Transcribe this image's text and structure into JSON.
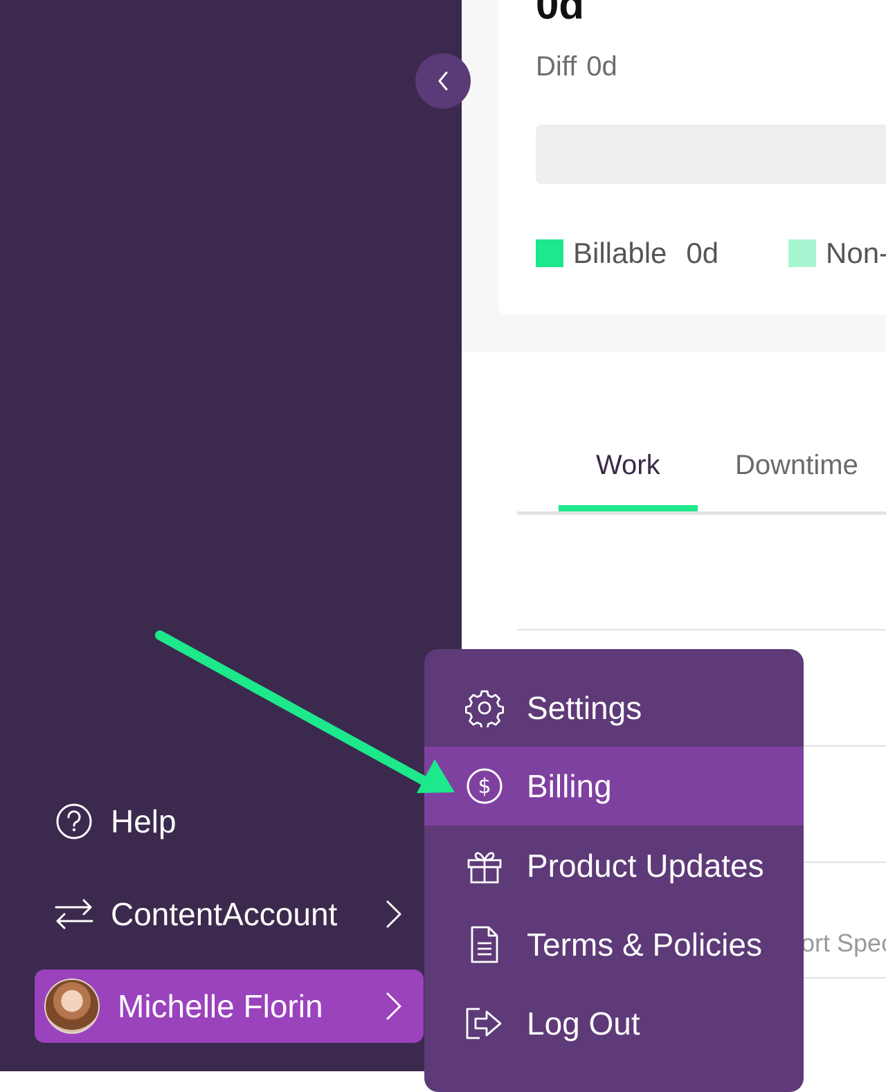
{
  "summary": {
    "big_value": "0d",
    "diff_label": "Diff",
    "diff_value": "0d",
    "legend": [
      {
        "label": "Billable",
        "value": "0d",
        "color": "#1de88b"
      },
      {
        "label": "Non-",
        "color": "#a8f5d2"
      }
    ]
  },
  "tabs": [
    {
      "label": "Work",
      "active": true
    },
    {
      "label": "Downtime",
      "active": false
    }
  ],
  "faded_text": "ort Spec",
  "sidebar": {
    "items": [
      {
        "label": "Help",
        "icon": "help-circle-icon"
      },
      {
        "label": "ContentAccount",
        "icon": "switch-arrows-icon"
      }
    ],
    "user": {
      "name": "Michelle Florin"
    }
  },
  "menu": {
    "items": [
      {
        "label": "Settings",
        "icon": "gear-icon"
      },
      {
        "label": "Billing",
        "icon": "dollar-circle-icon",
        "active": true
      },
      {
        "label": "Product Updates",
        "icon": "gift-icon"
      },
      {
        "label": "Terms & Policies",
        "icon": "document-icon"
      },
      {
        "label": "Log Out",
        "icon": "logout-icon"
      }
    ]
  },
  "colors": {
    "sidebar_bg": "#3b2a4d",
    "menu_bg": "#5e3a78",
    "menu_active": "#7f41a0",
    "user_item_bg": "#9b42bd",
    "accent_green": "#1de88b"
  }
}
